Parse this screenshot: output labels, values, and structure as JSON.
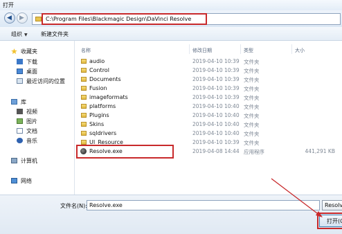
{
  "window": {
    "title": "打开"
  },
  "address": {
    "path": "C:\\Program Files\\Blackmagic Design\\DaVinci Resolve"
  },
  "toolbar": {
    "organize": "组织",
    "new_folder": "新建文件夹"
  },
  "sidebar": {
    "favorites": "收藏夹",
    "downloads": "下载",
    "desktop": "桌面",
    "recent": "最近访问的位置",
    "libraries": "库",
    "videos": "视频",
    "pictures": "图片",
    "documents": "文档",
    "music": "音乐",
    "computer": "计算机",
    "network": "网络"
  },
  "columns": {
    "name": "名称",
    "modified": "修改日期",
    "type": "类型",
    "size": "大小"
  },
  "files": [
    {
      "name": "audio",
      "modified": "2019-04-10 10:39",
      "type": "文件夹",
      "size": ""
    },
    {
      "name": "Control",
      "modified": "2019-04-10 10:39",
      "type": "文件夹",
      "size": ""
    },
    {
      "name": "Documents",
      "modified": "2019-04-10 10:39",
      "type": "文件夹",
      "size": ""
    },
    {
      "name": "Fusion",
      "modified": "2019-04-10 10:39",
      "type": "文件夹",
      "size": ""
    },
    {
      "name": "imageformats",
      "modified": "2019-04-10 10:39",
      "type": "文件夹",
      "size": ""
    },
    {
      "name": "platforms",
      "modified": "2019-04-10 10:40",
      "type": "文件夹",
      "size": ""
    },
    {
      "name": "Plugins",
      "modified": "2019-04-10 10:40",
      "type": "文件夹",
      "size": ""
    },
    {
      "name": "Skins",
      "modified": "2019-04-10 10:40",
      "type": "文件夹",
      "size": ""
    },
    {
      "name": "sqldrivers",
      "modified": "2019-04-10 10:40",
      "type": "文件夹",
      "size": ""
    },
    {
      "name": "UI_Resource",
      "modified": "2019-04-10 10:39",
      "type": "文件夹",
      "size": ""
    },
    {
      "name": "Resolve.exe",
      "modified": "2019-04-08 14:44",
      "type": "应用程序",
      "size": "441,291 KB"
    }
  ],
  "bottom": {
    "filename_label": "文件名(N):",
    "filename_value": "Resolve.exe",
    "filetype_value": "Resolv",
    "open_label": "打开(O)"
  },
  "colors": {
    "highlight": "#c8292b",
    "folder": "#e2b940"
  },
  "icons": {
    "back": "back-arrow-icon",
    "forward": "forward-arrow-icon",
    "folder": "folder-icon",
    "app": "resolve-app-icon"
  }
}
